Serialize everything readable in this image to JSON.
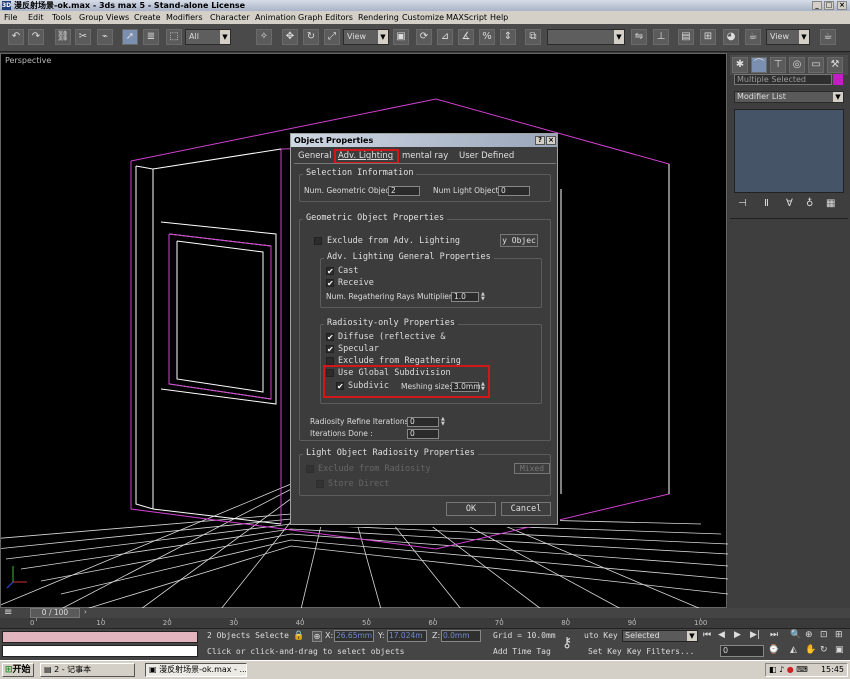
{
  "window": {
    "title": "漫反射场景-ok.max - 3ds max 5 - Stand-alone License"
  },
  "menu": [
    "File",
    "Edit",
    "Tools",
    "Group",
    "Views",
    "Create",
    "Modifiers",
    "Character",
    "Animation",
    "Graph Editors",
    "Rendering",
    "Customize",
    "MAXScript",
    "Help"
  ],
  "toolbar": {
    "selection_filter": "All",
    "reference_coord": "View",
    "named_sel": "",
    "view_dropdown": "View"
  },
  "viewport": {
    "label": "Perspective"
  },
  "command_panel": {
    "selection_text": "Multiple Selected",
    "modifier_list": "Modifier List"
  },
  "dialog": {
    "title": "Object Properties",
    "help_btn": "?",
    "close_btn": "×",
    "tabs": [
      "General",
      "Adv. Lighting",
      "mental ray",
      "User Defined"
    ],
    "selection_info": {
      "title": "Selection Information",
      "num_geo_label": "Num. Geometric Objects:",
      "num_geo_value": "2",
      "num_light_label": "Num Light Objects:",
      "num_light_value": "0"
    },
    "geo_props": {
      "title": "Geometric Object Properties",
      "exclude_label": "Exclude from Adv. Lighting",
      "by_object_btn": "y Objec",
      "general": {
        "title": "Adv. Lighting General Properties",
        "cast": "Cast",
        "receive": "Receive",
        "regather_label": "Num. Regathering Rays Multiplier:",
        "regather_value": "1.0"
      },
      "radiosity": {
        "title": "Radiosity-only Properties",
        "diffuse": "Diffuse (reflective &",
        "specular": "Specular",
        "exclude_regather": "Exclude from Regathering",
        "use_global": "Use Global Subdivision",
        "subdivide": "Subdivic",
        "meshing_label": "Meshing size:",
        "meshing_value": "3.0mm"
      },
      "refine_label": "Radiosity Refine Iterations :",
      "refine_value": "0",
      "done_label": "Iterations Done :",
      "done_value": "0"
    },
    "light_props": {
      "title": "Light Object Radiosity Properties",
      "exclude_label": "Exclude from Radiosity",
      "store_direct": "Store Direct",
      "mixed_btn": "Mixed"
    },
    "ok": "OK",
    "cancel": "Cancel"
  },
  "timeline": {
    "frame_label": "0 / 100",
    "ticks": [
      "0",
      "10",
      "20",
      "30",
      "40",
      "50",
      "60",
      "70",
      "80",
      "90",
      "100"
    ]
  },
  "status": {
    "objects_selected": "2 Objects Selecte",
    "x_label": "X:",
    "x_value": "26.65mm",
    "y_label": "Y:",
    "y_value": "17.024m",
    "z_label": "Z:",
    "z_value": "0.0mm",
    "grid": "Grid = 10.0mm",
    "prompt": "Click or click-and-drag to select objects",
    "add_time_tag": "Add Time Tag",
    "auto_key": "uto Key",
    "set_key": "Set Key",
    "selected": "Selected",
    "key_filters": "Key Filters...",
    "frame_value": "0"
  },
  "taskbar": {
    "start": "开始",
    "item1": "2 - 记事本",
    "item2": "漫反射场景-ok.max - ...",
    "clock": "15:45"
  }
}
